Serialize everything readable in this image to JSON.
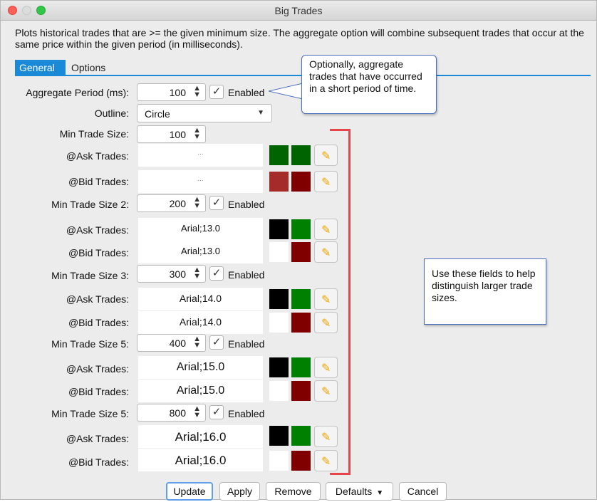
{
  "window": {
    "title": "Big Trades"
  },
  "description": "Plots historical trades that are >= the given minimum size.  The aggregate option will combine subsequent trades that occur at the same price within the given period (in milliseconds).",
  "tabs": [
    {
      "label": "General",
      "active": true
    },
    {
      "label": "Options",
      "active": false
    }
  ],
  "aggregate": {
    "label": "Aggregate Period (ms):",
    "value": "100",
    "enabled_label": "Enabled",
    "checked": true
  },
  "outline": {
    "label": "Outline:",
    "value": "Circle"
  },
  "groups": [
    {
      "label": "Min Trade Size:",
      "value": "100",
      "has_enabled": false,
      "ask": {
        "label": "@Ask Trades:",
        "font": "...",
        "colors": [
          "#006400",
          "#006400"
        ]
      },
      "bid": {
        "label": "@Bid Trades:",
        "font": "...",
        "colors": [
          "#a52a2a",
          "#800000"
        ]
      }
    },
    {
      "label": "Min Trade Size 2:",
      "value": "200",
      "has_enabled": true,
      "enabled_label": "Enabled",
      "ask": {
        "label": "@Ask Trades:",
        "font": "Arial;13.0",
        "colors": [
          "#000000",
          "#008000"
        ]
      },
      "bid": {
        "label": "@Bid Trades:",
        "font": "Arial;13.0",
        "colors": [
          "#ffffff",
          "#800000"
        ]
      }
    },
    {
      "label": "Min Trade Size 3:",
      "value": "300",
      "has_enabled": true,
      "enabled_label": "Enabled",
      "ask": {
        "label": "@Ask Trades:",
        "font": "Arial;14.0",
        "colors": [
          "#000000",
          "#008000"
        ]
      },
      "bid": {
        "label": "@Bid Trades:",
        "font": "Arial;14.0",
        "colors": [
          "#ffffff",
          "#800000"
        ]
      }
    },
    {
      "label": "Min Trade Size 5:",
      "value": "400",
      "has_enabled": true,
      "enabled_label": "Enabled",
      "ask": {
        "label": "@Ask Trades:",
        "font": "Arial;15.0",
        "colors": [
          "#000000",
          "#008000"
        ]
      },
      "bid": {
        "label": "@Bid Trades:",
        "font": "Arial;15.0",
        "colors": [
          "#ffffff",
          "#800000"
        ]
      }
    },
    {
      "label": "Min Trade Size 5:",
      "value": "800",
      "has_enabled": true,
      "enabled_label": "Enabled",
      "ask": {
        "label": "@Ask Trades:",
        "font": "Arial;16.0",
        "colors": [
          "#000000",
          "#008000"
        ]
      },
      "bid": {
        "label": "@Bid Trades:",
        "font": "Arial;16.0",
        "colors": [
          "#ffffff",
          "#800000"
        ]
      }
    }
  ],
  "callout": {
    "text": "Optionally, aggregate trades that have occurred in a short period of time."
  },
  "note": {
    "text": "Use these fields to help distinguish larger trade sizes."
  },
  "bracket_color": "#e8454a",
  "accent": "#1a8ad8",
  "icons": {
    "edit": "pencil-icon",
    "spin": "up-down-arrows-icon",
    "check": "checkmark-icon",
    "dropdown": "chevron-down-icon"
  },
  "buttons": {
    "update": "Update",
    "apply": "Apply",
    "remove": "Remove",
    "defaults": "Defaults",
    "cancel": "Cancel"
  }
}
